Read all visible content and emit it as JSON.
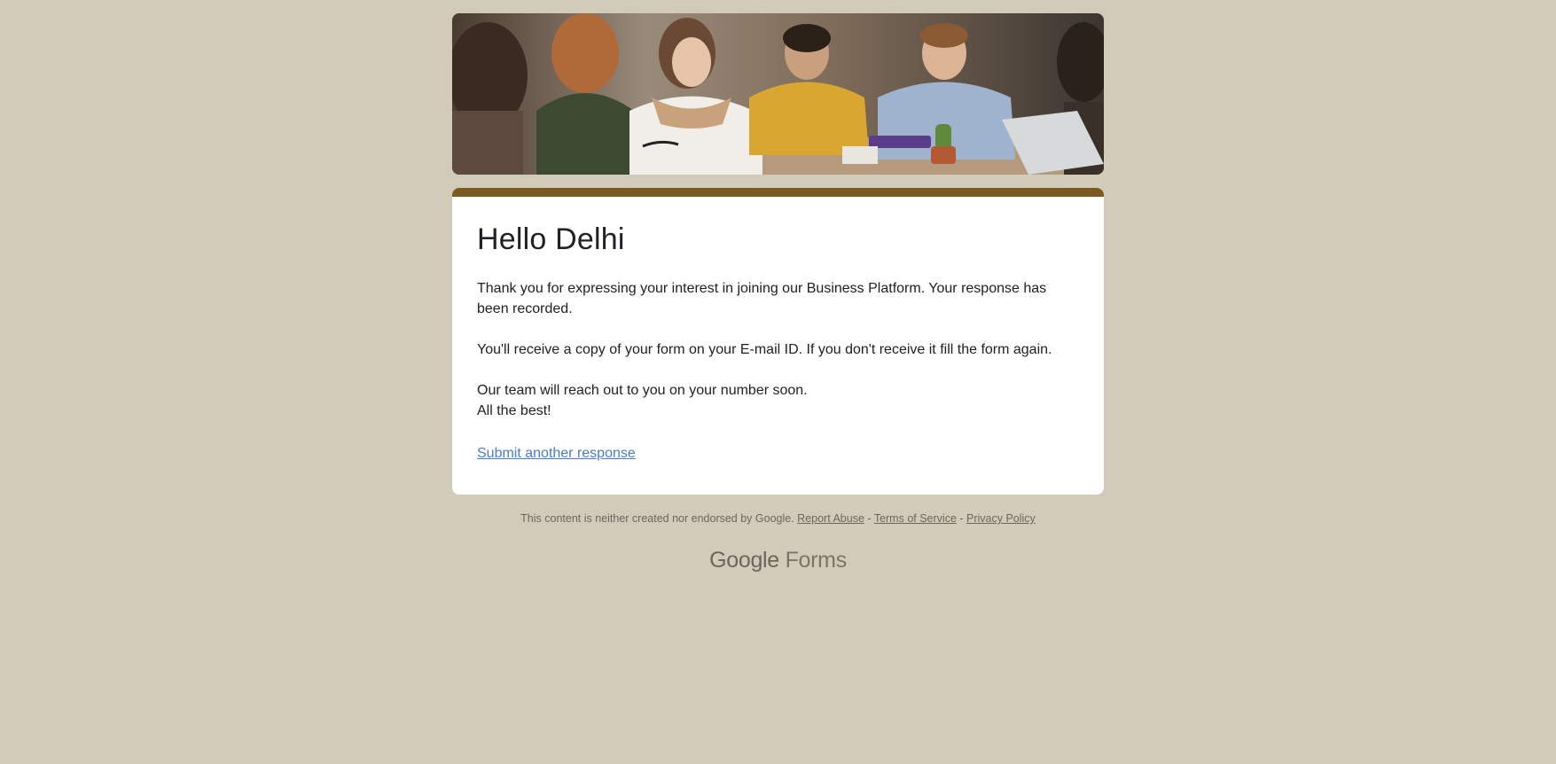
{
  "form": {
    "title": "Hello Delhi",
    "message": "Thank you for expressing your interest in joining our Business Platform. Your response has been recorded.\n\nYou'll receive a copy of your form on your E-mail ID. If you don't receive it fill the form again.\n\nOur team will reach out to you on your number soon.\nAll the best!",
    "submit_another": "Submit another response"
  },
  "footer": {
    "disclaimer": "This content is neither created nor endorsed by Google.",
    "report_abuse": "Report Abuse",
    "sep1": " - ",
    "terms": "Terms of Service",
    "sep2": " - ",
    "privacy": "Privacy Policy"
  },
  "brand": {
    "google": "Google",
    "forms": "Forms"
  },
  "colors": {
    "page_bg": "#d3cbba",
    "accent_bar": "#7a5a1e",
    "link": "#4a7cc7"
  }
}
